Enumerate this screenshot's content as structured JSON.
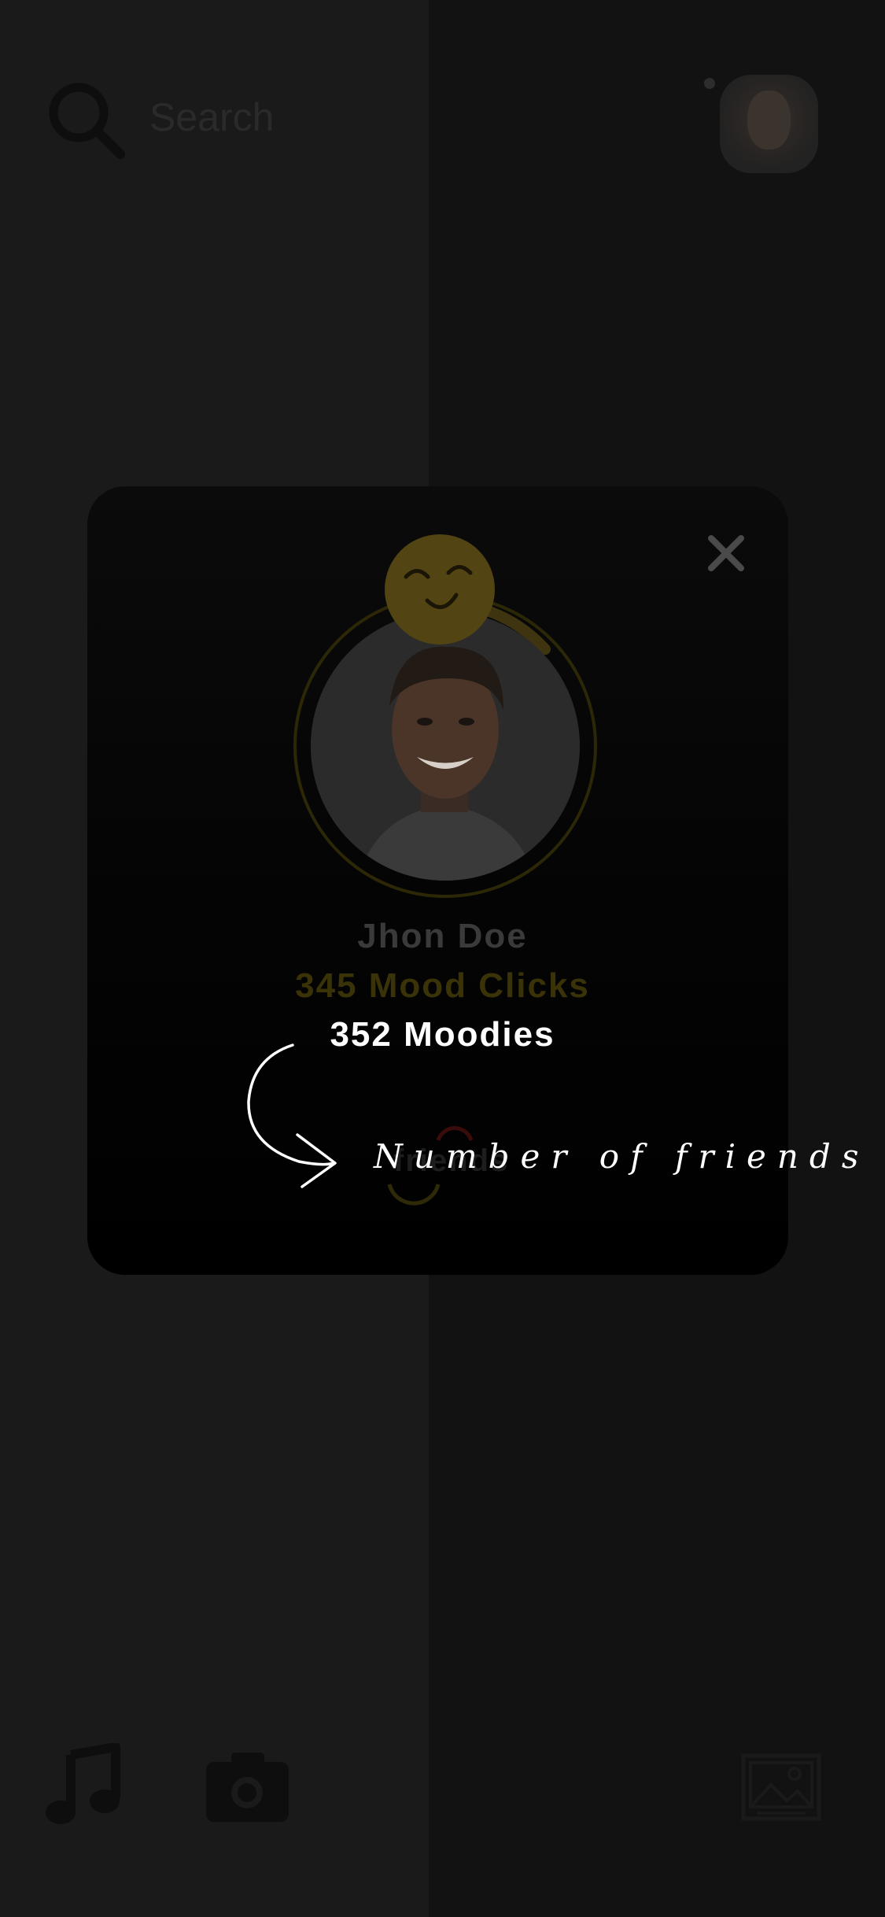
{
  "header": {
    "search_placeholder": "Search",
    "search_icon": "search-icon",
    "avatar_icon": "profile-avatar"
  },
  "modal": {
    "close_icon": "close-icon",
    "emoji_icon": "smile-emoji-icon",
    "name": "Jhon Doe",
    "mood_clicks": "345 Mood Clicks",
    "moodies": "352 Moodies",
    "friends_label": "friends",
    "annotation": "Number of friends"
  },
  "footer": {
    "music_icon": "music-note-icon",
    "camera_icon": "camera-icon",
    "gallery_icon": "gallery-icon"
  },
  "colors": {
    "accent_yellow": "#e0b81c",
    "modal_bg": "#000000",
    "page_bg": "#151515"
  }
}
